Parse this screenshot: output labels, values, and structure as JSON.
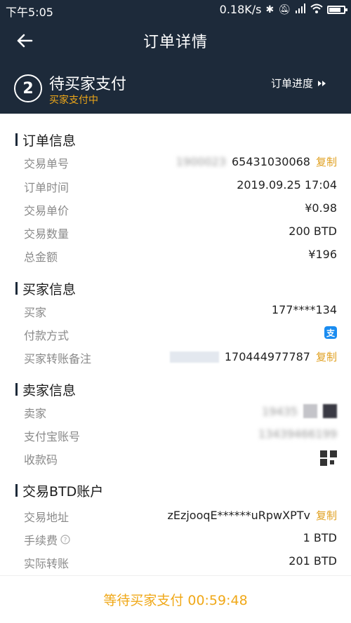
{
  "statusbar": {
    "time": "下午5:05",
    "speed": "0.18K/s",
    "bluetooth_icon": "bluetooth-icon",
    "mute_icon": "mute-icon",
    "signal_icon": "signal-icon",
    "wifi_icon": "wifi-icon",
    "battery_level": 0.8
  },
  "nav": {
    "title": "订单详情",
    "back_icon": "back-arrow-icon"
  },
  "status": {
    "step": "2",
    "title": "待买家支付",
    "subtitle": "买家支付中",
    "progress_label": "订单进度"
  },
  "order": {
    "heading": "订单信息",
    "rows": [
      {
        "label": "交易单号",
        "value": "65431030068",
        "copy": "复制"
      },
      {
        "label": "订单时间",
        "value": "2019.09.25 17:04"
      },
      {
        "label": "交易单价",
        "value": "¥0.98"
      },
      {
        "label": "交易数量",
        "value": "200 BTD"
      },
      {
        "label": "总金额",
        "value": "¥196"
      }
    ]
  },
  "buyer": {
    "heading": "买家信息",
    "rows": [
      {
        "label": "买家",
        "value": "177****134"
      },
      {
        "label": "付款方式",
        "value": "支"
      },
      {
        "label": "买家转账备注",
        "value": "170444977787",
        "copy": "复制"
      }
    ]
  },
  "seller": {
    "heading": "卖家信息",
    "rows": [
      {
        "label": "卖家"
      },
      {
        "label": "支付宝账号",
        "value": "13439466199"
      },
      {
        "label": "收款码"
      }
    ]
  },
  "btd": {
    "heading": "交易BTD账户",
    "rows": [
      {
        "label": "交易地址",
        "value": "zEzjooqE******uRpwXPTv",
        "copy": "复制"
      },
      {
        "label": "手续费",
        "value": "1 BTD"
      },
      {
        "label": "实际转账",
        "value": "201 BTD"
      }
    ]
  },
  "bottom": {
    "label": "等待买家支付 00:59:48"
  },
  "colors": {
    "header_bg": "#1d2a3a",
    "accent": "#f0a818"
  }
}
